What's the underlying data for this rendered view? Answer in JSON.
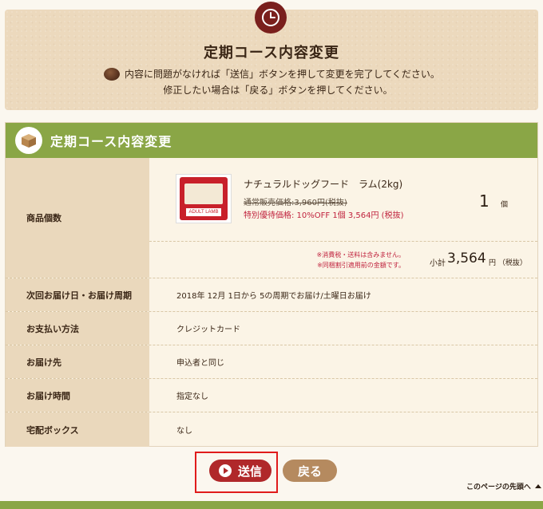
{
  "header": {
    "title": "定期コース内容変更",
    "line1": "内容に問題がなければ「送信」ボタンを押して変更を完了してください。",
    "line2": "修正したい場合は「戻る」ボタンを押してください。"
  },
  "section": {
    "title": "定期コース内容変更"
  },
  "product": {
    "label": "商品個数",
    "name": "ナチュラルドッグフード　ラム(2kg)",
    "regular_price": "通常販売価格:3,960円(税抜)",
    "special_price": "特別優待価格: 10%OFF 1個 3,564円 (税抜)",
    "quantity": "1",
    "quantity_unit": "個",
    "package_text": "ADULT LAMB",
    "note1": "※消費税・送料は含みません。",
    "note2": "※同梱割引適用前の金額です。",
    "subtotal_label": "小計",
    "subtotal_value": "3,564",
    "subtotal_unit": "円 （税抜）"
  },
  "rows": {
    "delivery": {
      "label": "次回お届け日・お届け周期",
      "value": "2018年 12月 1日から 5の周期でお届け/土曜日お届け"
    },
    "payment": {
      "label": "お支払い方法",
      "value": "クレジットカード"
    },
    "destination": {
      "label": "お届け先",
      "value": "申込者と同じ"
    },
    "time": {
      "label": "お届け時間",
      "value": "指定なし"
    },
    "box": {
      "label": "宅配ボックス",
      "value": "なし"
    }
  },
  "buttons": {
    "send": "送信",
    "back": "戻る"
  },
  "page_top": "このページの先頭へ",
  "colors": {
    "green": "#8aa646",
    "send_red": "#b0282a",
    "back_brown": "#b58a5f",
    "highlight": "#e01b1b",
    "price_red": "#c0233e"
  }
}
